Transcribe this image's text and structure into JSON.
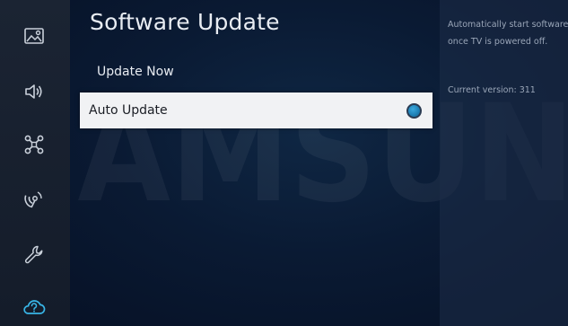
{
  "watermark": {
    "text": "SAMSUNG"
  },
  "sidebar": {
    "items": [
      {
        "icon": "picture-icon",
        "name": "Picture"
      },
      {
        "icon": "sound-icon",
        "name": "Sound"
      },
      {
        "icon": "connection-icon",
        "name": "Connection"
      },
      {
        "icon": "broadcast-icon",
        "name": "Broadcasting"
      },
      {
        "icon": "wrench-icon",
        "name": "General"
      },
      {
        "icon": "support-cloud-icon",
        "name": "Support",
        "active": true
      }
    ]
  },
  "main": {
    "title": "Software Update",
    "items": [
      {
        "label": "Update Now"
      },
      {
        "label": "Auto Update",
        "selected": true,
        "toggle_on": true
      }
    ]
  },
  "info": {
    "description": "Automatically start software updates once TV is powered off.",
    "version": "Current version: 311"
  },
  "colors": {
    "accent": "#1e7fb4",
    "selected_bg": "#f1f2f4",
    "sidebar_bg": "#1b2433"
  }
}
